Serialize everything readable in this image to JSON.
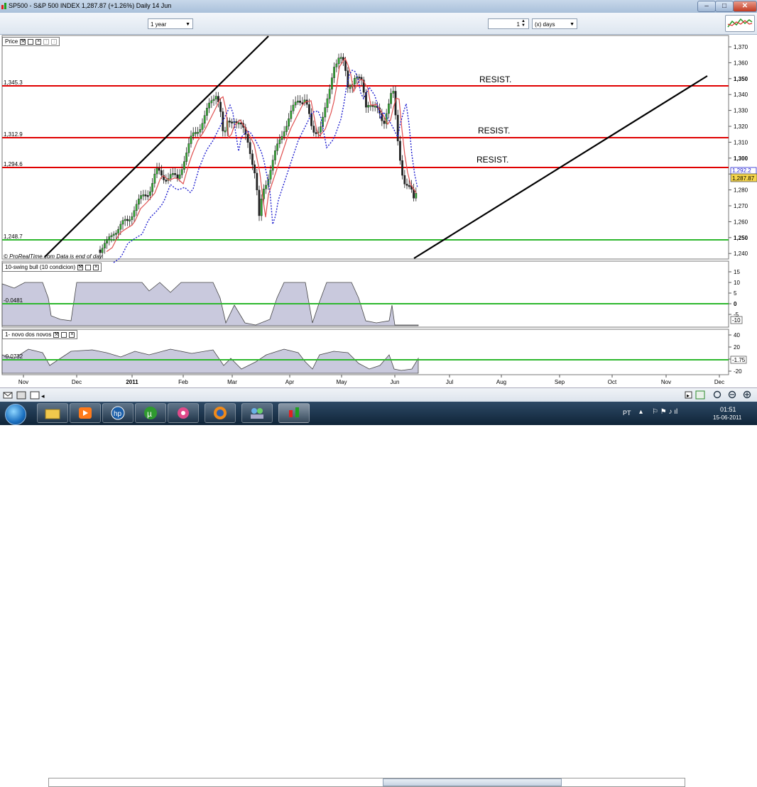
{
  "window": {
    "title": "SP500 - S&P 500 INDEX    1,287.87 (+1.26%)   Daily  14 Jun",
    "minimize_label": "–",
    "maximize_label": "□",
    "close_label": "✕"
  },
  "toolbar": {
    "period_value": "1 year",
    "units_value": "1",
    "units_type_value": "(x) days",
    "indicator_icon": "chart-indicator-icon"
  },
  "price_panel": {
    "title": "Price",
    "watermark": "© ProRealTime.com   Data is end of day",
    "y_ticks": [
      "1,370",
      "1,360",
      "1,350",
      "1,340",
      "1,330",
      "1,320",
      "1,310",
      "1,300",
      "1,290",
      "1,280",
      "1,270",
      "1,260",
      "1,250",
      "1,240"
    ],
    "bold_ticks": [
      "1,350",
      "1,300",
      "1,250"
    ],
    "levels": [
      {
        "value": "1,345.3",
        "label": "RESIST."
      },
      {
        "value": "1,312.9",
        "label": "RESIST."
      },
      {
        "value": "1,294.6",
        "label": "RESIST."
      },
      {
        "value": "1,248.7",
        "label": ""
      }
    ],
    "price_tag_1": "1,292.2",
    "price_tag_2": "1,287.87"
  },
  "swing_panel": {
    "title": "10-swing bull (10 condicion)",
    "left_value": "-0.0481",
    "y_ticks": [
      "15",
      "10",
      "5",
      "0",
      "-5"
    ],
    "value_tag": "-10"
  },
  "novo_panel": {
    "title": "1- novo dos novos",
    "left_value": "-0.0732",
    "y_ticks": [
      "40",
      "20",
      "0",
      "-20"
    ],
    "value_tag": "-1.75"
  },
  "x_axis": {
    "labels": [
      "Nov",
      "Dec",
      "2011",
      "Feb",
      "Mar",
      "Apr",
      "May",
      "Jun",
      "Jul",
      "Aug",
      "Sep",
      "Oct",
      "Nov",
      "Dec"
    ],
    "bold_label": "2011"
  },
  "taskbar": {
    "language": "PT",
    "time": "01:51",
    "date": "15-06-2011"
  },
  "colors": {
    "resistance_line": "#e00000",
    "support_line": "#2eb82e",
    "ma_red": "#e05050",
    "ma_blue": "#2020d0",
    "candle_up": "#33aa33",
    "candle_down": "#222222",
    "oscillator_fill": "#c9c9dd"
  }
}
